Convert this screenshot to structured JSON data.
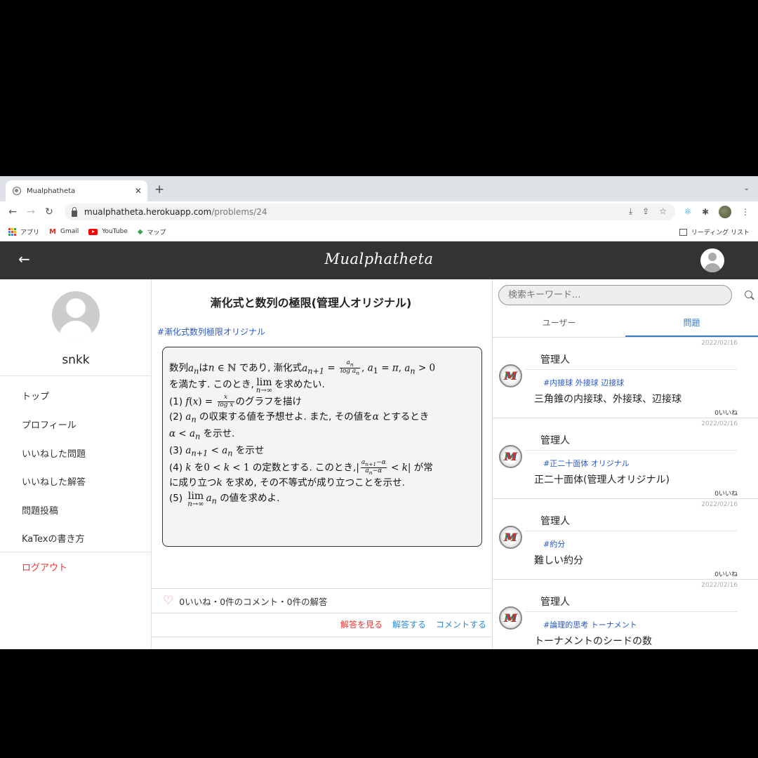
{
  "browser": {
    "tab_title": "Mualphatheta",
    "new_tab": "+",
    "url_host": "mualphatheta.herokuapp.com",
    "url_path": "/problems/24",
    "bookmarks": [
      {
        "label": "アプリ",
        "icon": "apps-grid-icon"
      },
      {
        "label": "Gmail",
        "icon": "gmail-icon"
      },
      {
        "label": "YouTube",
        "icon": "youtube-icon"
      },
      {
        "label": "マップ",
        "icon": "maps-icon"
      }
    ],
    "reading_list": "リーディング リスト"
  },
  "header": {
    "brand": "Mualphatheta"
  },
  "sidebar": {
    "username": "snkk",
    "menu": [
      {
        "label": "トップ"
      },
      {
        "label": "プロフィール"
      },
      {
        "label": "いいねした問題"
      },
      {
        "label": "いいねした解答"
      },
      {
        "label": "問題投稿"
      },
      {
        "label": "KaTexの書き方"
      }
    ],
    "logout": "ログアウト"
  },
  "problem": {
    "title": "漸化式と数列の極限(管理人オリジナル)",
    "tag": "#漸化式数列極限オリジナル",
    "text": {
      "l1a": "数列",
      "l1b": "は",
      "l1c": "であり, 漸化式",
      "l2a": "を満たす. このとき,",
      "l2b": "を求めたい.",
      "p1a": "(1)",
      "p1b": "のグラフを描け",
      "p2a": "(2)",
      "p2b": "の収束する値を予想せよ. また, その値を",
      "p2c": "とするとき",
      "p2d": "を示せ.",
      "p3a": "(3)",
      "p3b": "を示せ",
      "p4a": "(4)",
      "p4b": "を",
      "p4c": "の定数とする. このとき,",
      "p4d": "が常",
      "p4e": "に成り立つ",
      "p4f": "を求め, その不等式が成り立つことを示せ.",
      "p5a": "(5)",
      "p5b": "の値を求めよ."
    },
    "stats": "0いいね・0件のコメント・0件の解答",
    "actions": {
      "view_answers": "解答を見る",
      "answer": "解答する",
      "comment": "コメントする"
    }
  },
  "right_panel": {
    "search_placeholder": "検索キーワード...",
    "tabs": [
      {
        "label": "ユーザー",
        "active": false
      },
      {
        "label": "問題",
        "active": true
      }
    ],
    "cards": [
      {
        "date": "2022/02/16",
        "user": "管理人",
        "tags": "#内接球 外接球 辺接球",
        "title": "三角錐の内接球、外接球、辺接球",
        "likes": "0いいね"
      },
      {
        "date": "2022/02/16",
        "user": "管理人",
        "tags": "#正二十面体 オリジナル",
        "title": "正二十面体(管理人オリジナル)",
        "likes": "0いいね"
      },
      {
        "date": "2022/02/16",
        "user": "管理人",
        "tags": "#約分",
        "title": "難しい約分",
        "likes": "0いいね"
      },
      {
        "date": "2022/02/16",
        "user": "管理人",
        "tags": "#論理的思考 トーナメント",
        "title": "トーナメントのシードの数",
        "likes": ""
      }
    ]
  },
  "colors": {
    "app_header": "#333333",
    "link_blue": "#2a58c8",
    "logout_red": "#ee3333",
    "tab_active": "#3a78c8"
  }
}
